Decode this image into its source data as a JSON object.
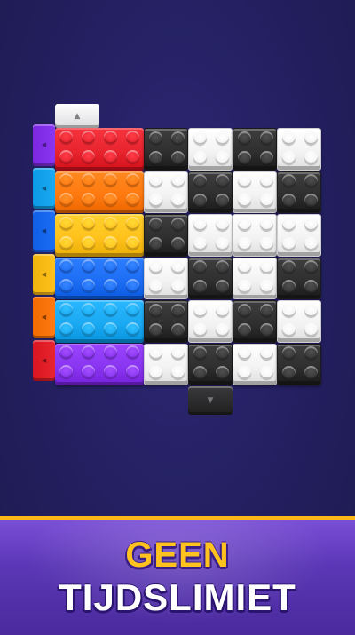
{
  "banner": {
    "line1": "GEEN",
    "line2": "TIJDSLIMIET"
  },
  "colors": {
    "red": "#e8242f",
    "orange": "#ff7a10",
    "yellow": "#ffc21d",
    "blue": "#1e6ef5",
    "cyan": "#1aa9f2",
    "purple": "#8a35f0",
    "black": "#2f2f30",
    "white": "#f3f3f3",
    "highlight": "#ffb619"
  },
  "board": {
    "columns": 6,
    "rows": 6,
    "grid": [
      [
        "red",
        "red",
        "black",
        "white",
        "black",
        "white"
      ],
      [
        "orange",
        "orange",
        "white",
        "black",
        "white",
        "black"
      ],
      [
        "yellow",
        "yellow",
        "black",
        "white",
        "white",
        "white"
      ],
      [
        "blue",
        "blue",
        "white",
        "black",
        "white",
        "black"
      ],
      [
        "cyan",
        "cyan",
        "black",
        "white",
        "black",
        "white"
      ],
      [
        "purple",
        "purple",
        "white",
        "black",
        "white",
        "black"
      ]
    ],
    "side_tabs": [
      "purple",
      "cyan",
      "blue",
      "yellow",
      "orange",
      "red"
    ],
    "top_tab": "white",
    "bottom_tab": "black"
  },
  "icons": {
    "up": "▲",
    "down": "▼",
    "left": "◀"
  }
}
